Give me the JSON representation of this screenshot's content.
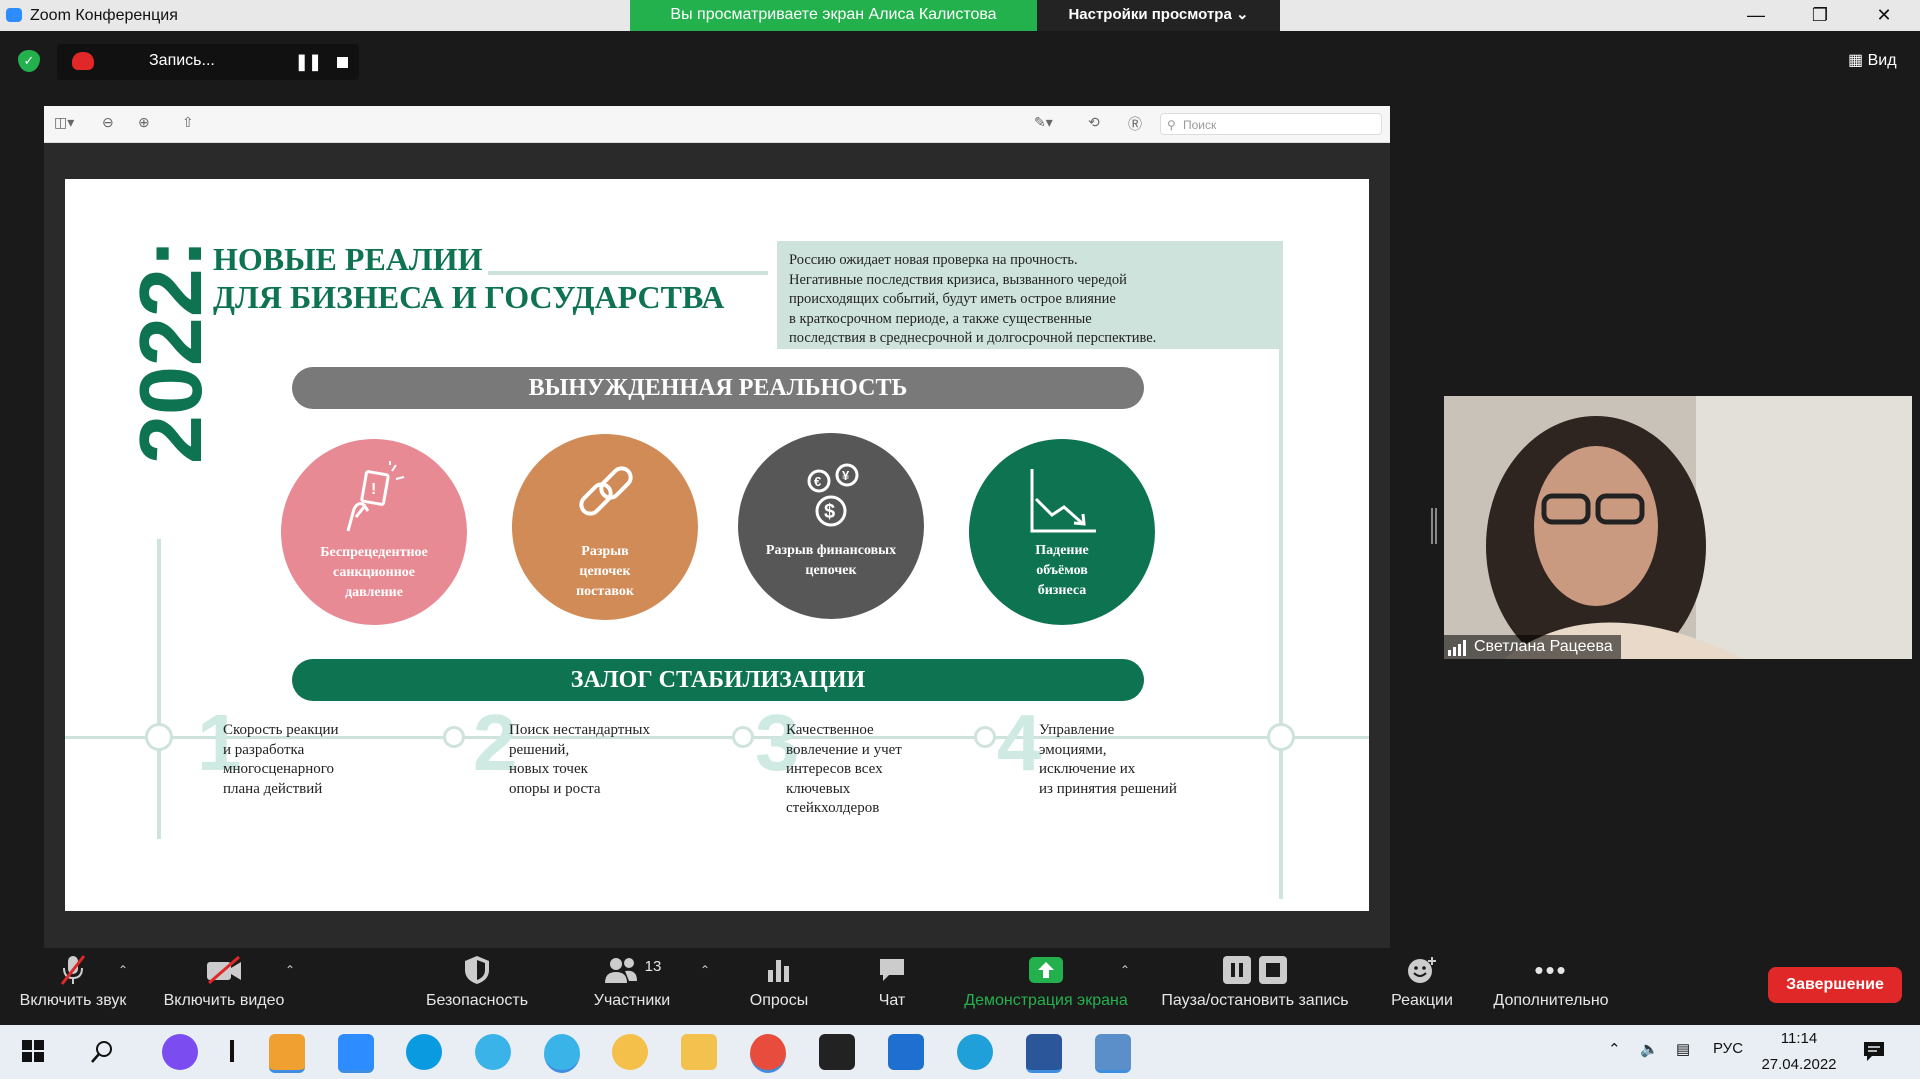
{
  "window": {
    "title": "Zoom Конференция",
    "share_banner": "Вы просматриваете экран Алиса Калистова",
    "view_options": "Настройки просмотра"
  },
  "recording": {
    "label": "Запись..."
  },
  "view_button": "Вид",
  "doc_viewer": {
    "search_placeholder": "Поиск"
  },
  "slide": {
    "year": "2022:",
    "title_line1": "НОВЫЕ РЕАЛИИ",
    "title_line2": "ДЛЯ БИЗНЕСА И ГОСУДАРСТВА",
    "info_text": [
      "Россию ожидает новая проверка на прочность.",
      "Негативные последствия кризиса, вызванного чередой",
      "происходящих событий, будут иметь острое влияние",
      "в краткосрочном периоде, а также существенные",
      "последствия в среднесрочной и долгосрочной перспективе."
    ],
    "banner_forced": "ВЫНУЖДЕННАЯ РЕАЛЬНОСТЬ",
    "circles": [
      {
        "label": [
          "Беспрецедентное",
          "санкционное",
          "давление"
        ],
        "color": "#e88a93",
        "icon": "hand-card-icon"
      },
      {
        "label": [
          "Разрыв",
          "цепочек",
          "поставок"
        ],
        "color": "#d08b57",
        "icon": "broken-chain-icon"
      },
      {
        "label": [
          "Разрыв финансовых",
          "цепочек"
        ],
        "color": "#575757",
        "icon": "currency-coins-icon"
      },
      {
        "label": [
          "Падение",
          "объёмов",
          "бизнеса"
        ],
        "color": "#0e7350",
        "icon": "downtrend-chart-icon"
      }
    ],
    "banner_stabilization": "ЗАЛОГ СТАБИЛИЗАЦИИ",
    "steps": [
      {
        "num": "1",
        "text": [
          "Скорость реакции",
          "и разработка",
          "многосценарного",
          "плана действий"
        ]
      },
      {
        "num": "2",
        "text": [
          "Поиск нестандартных",
          "решений,",
          "новых точек",
          "опоры и роста"
        ]
      },
      {
        "num": "3",
        "text": [
          "Качественное",
          "вовлечение и учет",
          "интересов всех",
          "ключевых",
          "стейкхолдеров"
        ]
      },
      {
        "num": "4",
        "text": [
          "Управление",
          "эмоциями,",
          "исключение их",
          "из принятия решений"
        ]
      }
    ]
  },
  "participant": {
    "name": "Светлана Рацеева"
  },
  "controls": {
    "unmute": "Включить звук",
    "start_video": "Включить видео",
    "security": "Безопасность",
    "participants": "Участники",
    "participants_count": "13",
    "polls": "Опросы",
    "chat": "Чат",
    "share_screen": "Демонстрация экрана",
    "pause_record": "Пауза/остановить запись",
    "reactions": "Реакции",
    "more": "Дополнительно",
    "end": "Завершение"
  },
  "taskbar": {
    "language": "РУС",
    "time": "11:14",
    "date": "27.04.2022"
  },
  "colors": {
    "brand_green": "#0e7350",
    "share_green": "#23b14d",
    "end_red": "#e02828",
    "mint": "#cfe3dd"
  }
}
